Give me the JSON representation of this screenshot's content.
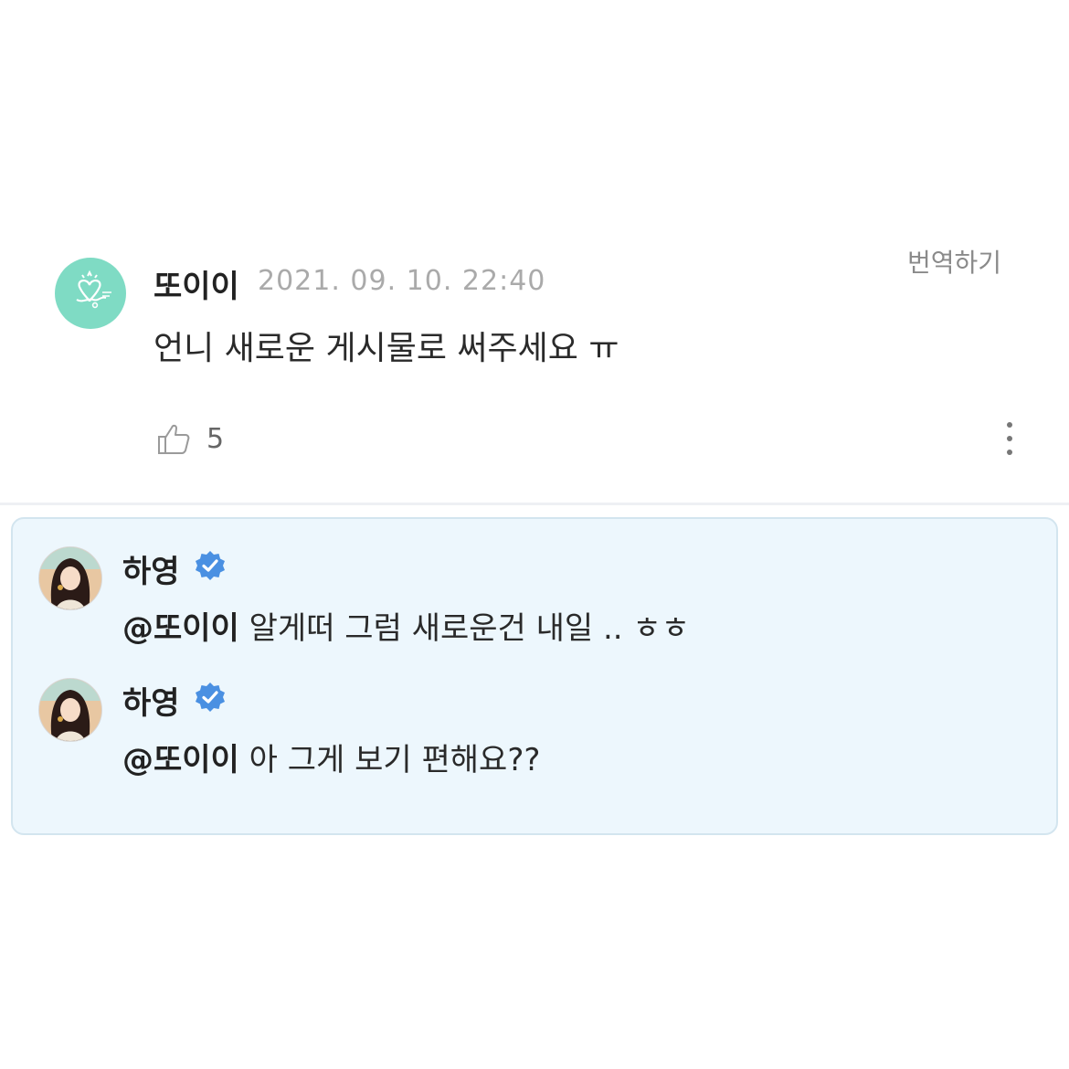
{
  "comment": {
    "author": "또이이",
    "date": "2021. 09. 10. 22:40",
    "translate_label": "번역하기",
    "text": "언니 새로운 게시물로 써주세요 ㅠ",
    "like_count": "5",
    "avatar_icon": "signature-heart-logo-icon",
    "avatar_color": "#7fdbc4"
  },
  "replies": [
    {
      "author": "하영",
      "verified_icon": "verified-badge-icon",
      "mention": "@또이이",
      "text": "알게떠 그럼 새로운건 내일 .. ㅎㅎ"
    },
    {
      "author": "하영",
      "verified_icon": "verified-badge-icon",
      "mention": "@또이이",
      "text": "아 그게 보기 편해요??"
    }
  ],
  "colors": {
    "reply_background": "#edf7fd",
    "reply_border": "#d3e5ef",
    "verified_blue": "#4a90e2",
    "date_gray": "#aaaaaa"
  }
}
